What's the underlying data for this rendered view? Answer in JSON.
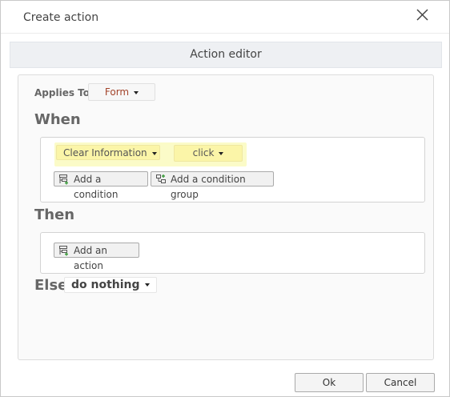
{
  "dialog": {
    "title": "Create action",
    "close_icon": "close-icon",
    "editor_header": "Action editor"
  },
  "applies_to": {
    "label": "Applies To",
    "value": "Form",
    "value_color": "#a3442b"
  },
  "when": {
    "label": "When",
    "trigger_source": "Clear Information",
    "trigger_event": "click",
    "highlight_color": "#fbfbc8",
    "add_condition": "Add a condition",
    "add_condition_group": "Add a condition group"
  },
  "then": {
    "label": "Then",
    "add_action": "Add an action"
  },
  "else": {
    "label": "Else",
    "value": "do nothing"
  },
  "footer": {
    "ok": "Ok",
    "cancel": "Cancel"
  }
}
